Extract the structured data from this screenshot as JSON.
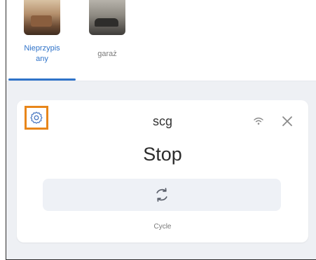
{
  "rooms": {
    "tabs": [
      {
        "label": "Nieprzypis\nany",
        "selected": true,
        "thumbnail": "living-room-photo"
      },
      {
        "label": "garaż",
        "selected": false,
        "thumbnail": "garage-photo"
      }
    ]
  },
  "device": {
    "name": "scg",
    "state": "Stop",
    "action_label": "Cycle",
    "icons": {
      "settings": "gear-icon",
      "wifi": "wifi-icon",
      "close": "close-icon",
      "action": "cycle-icon"
    }
  },
  "colors": {
    "accent": "#2f73c9",
    "highlight": "#e8861a",
    "background": "#eef0f4",
    "card": "#ffffff"
  }
}
